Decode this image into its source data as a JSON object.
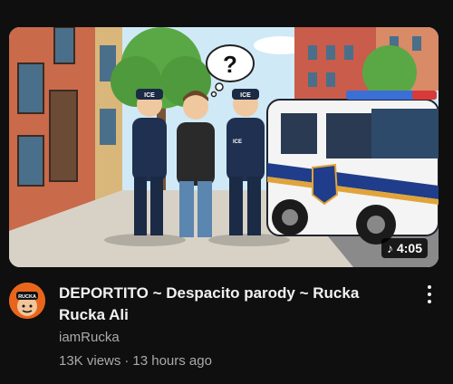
{
  "video": {
    "duration": "4:05",
    "title": "DEPORTITO ~ Despacito parody ~ Rucka Rucka Ali",
    "channel": "iamRucka",
    "views": "13K views",
    "separator": "·",
    "age": "13 hours ago"
  },
  "thumbnail": {
    "badge_text": "ICE",
    "avatar_text": "RUCKA",
    "question_mark": "?"
  },
  "icons": {
    "duration": "music-note-icon",
    "menu": "more-vert-icon"
  },
  "colors": {
    "background": "#0f0f0f",
    "title": "#f1f1f1",
    "secondary": "#aaaaaa",
    "avatar": "#e8661c"
  }
}
